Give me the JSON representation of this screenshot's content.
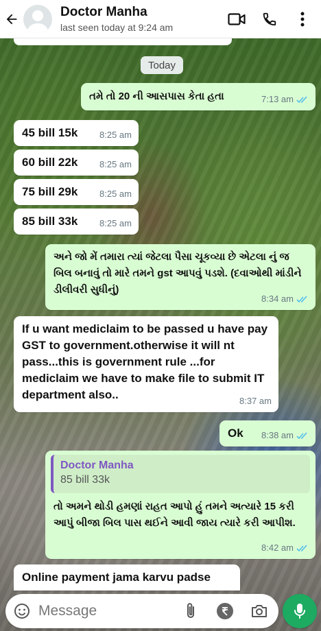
{
  "header": {
    "name": "Doctor Manha",
    "status": "last seen today at 9:24 am"
  },
  "chat": {
    "date_label": "Today",
    "messages": [
      {
        "dir": "out",
        "text": "તમે તો 20 ની આસપાસ કેતા હતા",
        "time": "7:13 am",
        "read": true
      },
      {
        "dir": "in",
        "text": "45 bill 15k",
        "time": "8:25 am"
      },
      {
        "dir": "in",
        "text": "60 bill 22k",
        "time": "8:25 am"
      },
      {
        "dir": "in",
        "text": "75 bill 29k",
        "time": "8:25 am"
      },
      {
        "dir": "in",
        "text": "85 bill 33k",
        "time": "8:25 am"
      },
      {
        "dir": "out",
        "text": "અને જો મેં તમારા ત્યાં જેટલા પૈસા ચૂકવ્યા છે એટલા નું જ બિલ બનાવું તો મારે તમને gst આપવું પડશે. (દવાઓથી માંડીને ડીલીવરી સુધીનું)",
        "time": "8:34 am",
        "read": true
      },
      {
        "dir": "in",
        "text": "If u want mediclaim to be passed u have pay GST to government.otherwise it will nt pass...this is government rule ...for mediclaim we have to make file to submit IT department also..",
        "time": "8:37 am"
      },
      {
        "dir": "out",
        "text": "Ok",
        "time": "8:38 am",
        "read": true
      },
      {
        "dir": "out",
        "quote_name": "Doctor Manha",
        "quote_text": "85 bill 33k",
        "text": "તો અમને થોડી હમણાં રાહત આપો હું તમને અત્યારે 15 કરી આપું બીજા બિલ પાસ થઈને આવી જાય ત્યારે કરી આપીશ.",
        "time": "8:42 am",
        "read": true
      },
      {
        "dir": "in",
        "text": "Online payment jama karvu padse",
        "time": ""
      }
    ]
  },
  "composer": {
    "placeholder": "Message"
  },
  "colors": {
    "outgoing_bubble": "#d9fdd3",
    "incoming_bubble": "#ffffff",
    "read_ticks": "#53bdeb",
    "mic_button": "#1daa61",
    "quote_accent": "#7e57c2"
  },
  "icons": [
    "back-arrow-icon",
    "video-call-icon",
    "phone-icon",
    "more-vert-icon",
    "emoji-icon",
    "attach-icon",
    "rupee-icon",
    "camera-icon",
    "mic-icon",
    "double-tick-icon"
  ]
}
